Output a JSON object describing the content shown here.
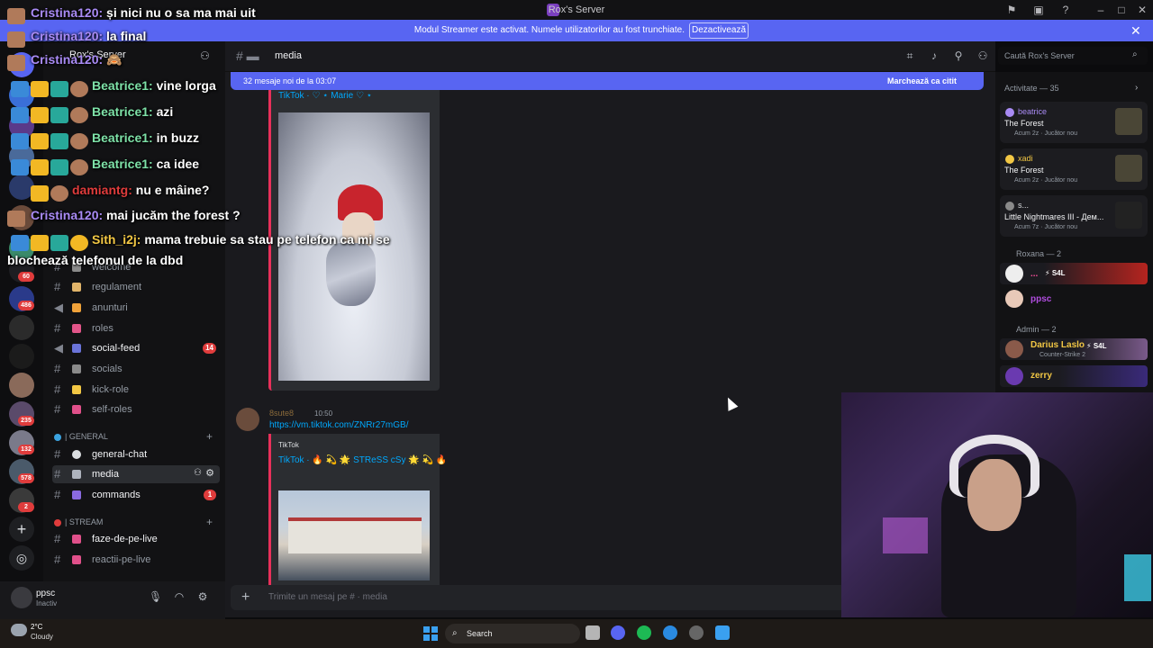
{
  "window": {
    "title": "Rox's Server"
  },
  "banner": {
    "text": "Modul Streamer este activat. Numele utilizatorilor au fost trunchiate.",
    "button": "Dezactivează",
    "close": "✕"
  },
  "guild_badges": [
    "60",
    "486",
    "235",
    "132",
    "578",
    "2"
  ],
  "server": {
    "name": "Rox's Server"
  },
  "channels": [
    {
      "name": "welcome",
      "emoji_color": "#8a8a8a"
    },
    {
      "name": "regulament",
      "emoji_color": "#e0b46a"
    },
    {
      "name": "anunturi",
      "emoji_color": "#f0a23a"
    },
    {
      "name": "roles",
      "emoji_color": "#e25589"
    },
    {
      "name": "social-feed",
      "emoji_color": "#6a73d8",
      "badge": "14"
    },
    {
      "name": "socials",
      "emoji_color": "#8a8a8a"
    },
    {
      "name": "kick-role",
      "emoji_color": "#f2c744"
    },
    {
      "name": "self-roles",
      "emoji_color": "#e0508a"
    }
  ],
  "categories": {
    "general": "| GENERAL",
    "stream": "| STREAM"
  },
  "general_channels": [
    {
      "name": "general-chat"
    },
    {
      "name": "media"
    },
    {
      "name": "commands",
      "badge": "1"
    }
  ],
  "stream_channels": [
    {
      "name": "faze-de-pe-live"
    },
    {
      "name": "reactii-pe-live"
    }
  ],
  "user": {
    "name": "ppsc",
    "status": "Inactiv"
  },
  "header": {
    "channel": "media",
    "search_placeholder": "Caută Rox's Server"
  },
  "new_messages": {
    "text": "32 mesaje noi de la 03:07",
    "mark_read": "Marchează ca citit"
  },
  "messages": [
    {
      "embed_title": "TikTok · ♡ ⋆ Marie ♡ ⋆"
    },
    {
      "author": "8sute8",
      "time": "10:50",
      "link": "https://vm.tiktok.com/ZNRr27mGB/",
      "embed_provider": "TikTok",
      "embed_title": "TikTok · 🔥 💫 🌟 STReSS cSy 🌟 💫 🔥"
    }
  ],
  "composer": {
    "placeholder": "Trimite un mesaj pe #  · media"
  },
  "activity": {
    "header": "Activitate — 35",
    "cards": [
      {
        "name": "beatrice",
        "name_color": "#a98bf5",
        "game": "The Forest",
        "meta": "Acum 2z · Jucător nou"
      },
      {
        "name": "xadi",
        "name_color": "#f2c744",
        "game": "The Forest",
        "meta": "Acum 2z · Jucător nou"
      },
      {
        "name": "s...",
        "name_color": "#dbdee1",
        "game": "Little Nightmares III - Дем...",
        "meta": "Acum 7z · Jucător nou"
      }
    ]
  },
  "roles": [
    {
      "title": "Roxana — 2",
      "members": [
        {
          "name": "...",
          "tag": "⚡ S4L",
          "color": "#ee4d96"
        },
        {
          "name": "ppsc",
          "color": "#b14de0"
        }
      ]
    },
    {
      "title": "Admin — 2",
      "members": [
        {
          "name": "Darius Laslo",
          "tag": "⚡ S4L",
          "sub": "Counter-Strike 2",
          "color": "#f2c744"
        },
        {
          "name": "zerry",
          "color": "#f2c744"
        }
      ]
    }
  ],
  "overlay_chat": [
    {
      "user": "Cristina120:",
      "msg": "și nici nu o sa ma mai uit"
    },
    {
      "user": "Cristina120:",
      "msg": "la final"
    },
    {
      "user": "Cristina120:",
      "msg": "🙈"
    },
    {
      "user": "Beatrice1:",
      "msg": "vine lorga"
    },
    {
      "user": "Beatrice1:",
      "msg": "azi"
    },
    {
      "user": "Beatrice1:",
      "msg": "in buzz"
    },
    {
      "user": "Beatrice1:",
      "msg": "ca idee"
    },
    {
      "user": "damiantg:",
      "msg": "nu e mâine?"
    },
    {
      "user": "Cristina120:",
      "msg": "mai jucăm the forest ?"
    },
    {
      "user": "Sith_i2j:",
      "msg": "mama trebuie sa stau pe telefon ca mi se"
    },
    {
      "user": "",
      "msg": "blochează telefonul de la dbd"
    }
  ],
  "taskbar": {
    "temp": "2°C",
    "weather": "Cloudy",
    "search": "Search"
  }
}
